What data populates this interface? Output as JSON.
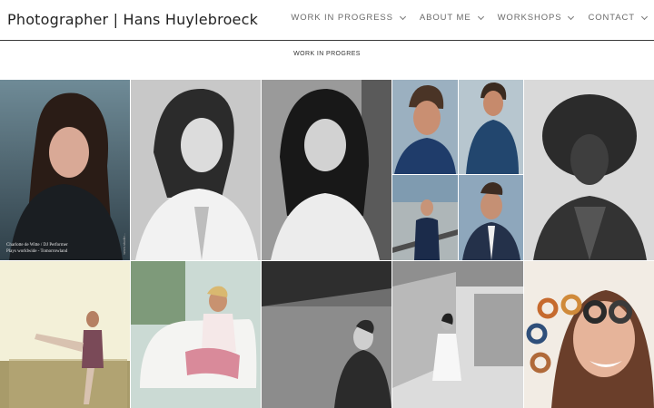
{
  "header": {
    "site_title": "Photographer | Hans Huylebroeck",
    "nav": [
      {
        "label": "WORK IN PROGRESS"
      },
      {
        "label": "ABOUT ME"
      },
      {
        "label": "WORKSHOPS"
      },
      {
        "label": "CONTACT"
      }
    ]
  },
  "page": {
    "heading": "WORK IN PROGRES"
  },
  "gallery": {
    "tile1_caption": {
      "line1": "Charlotte de Witte / DJ Performer",
      "line2": "Plays worldwide - Tomorrowland",
      "watermark": "www.studio..."
    }
  }
}
